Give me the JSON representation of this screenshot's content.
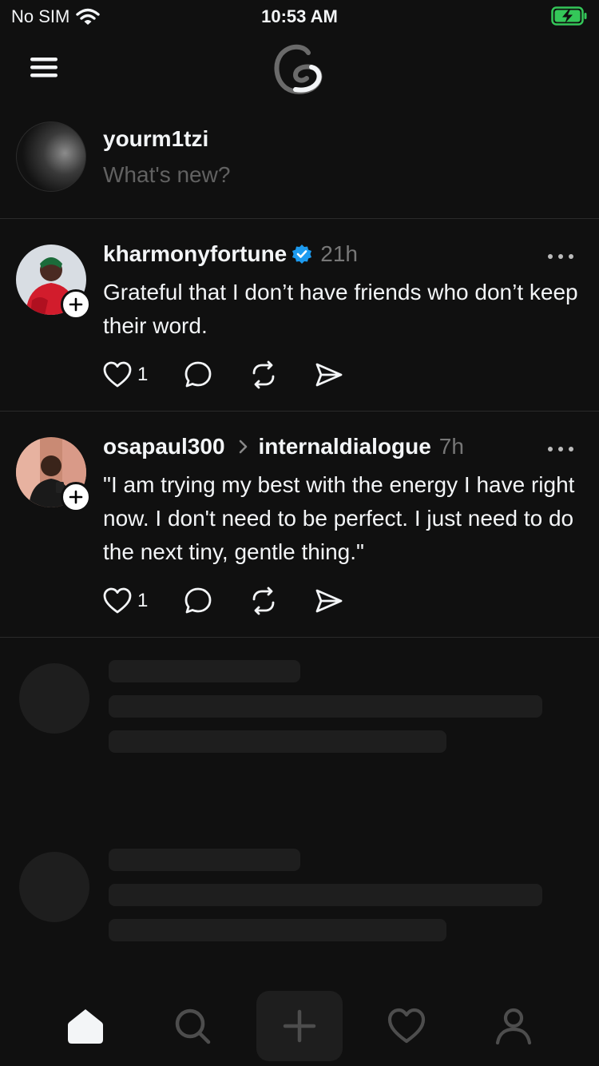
{
  "status_bar": {
    "carrier": "No SIM",
    "time": "10:53 AM"
  },
  "composer": {
    "username": "yourm1tzi",
    "placeholder": "What's new?"
  },
  "posts": [
    {
      "username": "kharmonyfortune",
      "verified": true,
      "time": "21h",
      "text": "Grateful that I don’t have friends who don’t keep their word.",
      "like_count": "1"
    },
    {
      "username": "osapaul300",
      "reply_to": "internaldialogue",
      "time": "7h",
      "text": "\"I am trying my best with the energy I have right now. I don't need to be perfect. I just need to do the next tiny, gentle thing.\"",
      "like_count": "1"
    }
  ],
  "tabbar": {
    "items": [
      "home-icon",
      "search-icon",
      "create-icon",
      "activity-heart-icon",
      "profile-icon"
    ]
  },
  "colors": {
    "background": "#101010",
    "verified": "#1d9bf0",
    "battery": "#34c759",
    "secondary_text": "#777777"
  }
}
